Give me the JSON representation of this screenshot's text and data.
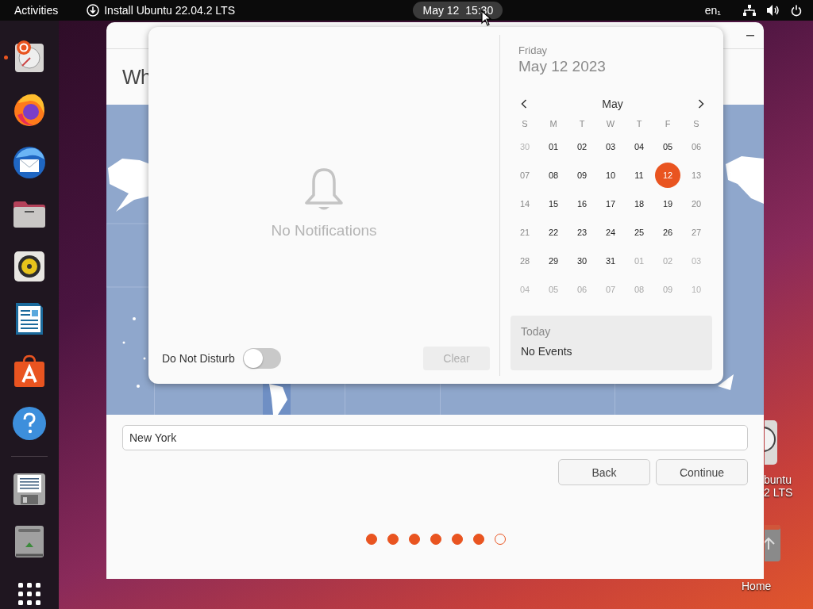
{
  "top_bar": {
    "activities": "Activities",
    "app_menu": "Install Ubuntu 22.04.2 LTS",
    "clock": "May 12  15:30",
    "clock_selected": true,
    "keyboard_layout": "en₁"
  },
  "dock": {
    "items": [
      {
        "kind": "installer",
        "running": true
      },
      {
        "kind": "firefox",
        "running": false
      },
      {
        "kind": "thunderbird",
        "running": false
      },
      {
        "kind": "files",
        "running": false
      },
      {
        "kind": "rhythmbox",
        "running": false
      },
      {
        "kind": "writer",
        "running": false
      },
      {
        "kind": "software",
        "running": false
      },
      {
        "kind": "help",
        "running": false
      },
      {
        "kind": "separator"
      },
      {
        "kind": "save",
        "running": false
      },
      {
        "kind": "trash",
        "running": false
      },
      {
        "kind": "apps",
        "running": false
      }
    ]
  },
  "desktop_icons": [
    {
      "kind": "installer",
      "label_lines": [
        "buntu",
        "2 LTS"
      ]
    },
    {
      "kind": "home",
      "label_lines": [
        "Home"
      ]
    }
  ],
  "installer": {
    "heading": "Wh",
    "location": "New York",
    "buttons": [
      "Back",
      "Continue"
    ],
    "progress": [
      {
        "filled": true
      },
      {
        "filled": true
      },
      {
        "filled": true
      },
      {
        "filled": true
      },
      {
        "filled": true
      },
      {
        "filled": true
      },
      {
        "filled": false
      }
    ]
  },
  "popover": {
    "notifications": {
      "empty_text": "No Notifications",
      "dnd_label": "Do Not Disturb",
      "dnd_on": false,
      "clear": "Clear",
      "clear_disabled": true
    },
    "calendar": {
      "weekday": "Friday",
      "date": "May 12 2023",
      "month": "May",
      "day_headers": [
        "S",
        "M",
        "T",
        "W",
        "T",
        "F",
        "S"
      ],
      "weeks": [
        [
          {
            "day": "30",
            "kind": "other_weekend",
            "selected": false
          },
          {
            "day": "01",
            "kind": "weekday",
            "selected": false
          },
          {
            "day": "02",
            "kind": "weekday",
            "selected": false
          },
          {
            "day": "03",
            "kind": "weekday",
            "selected": false
          },
          {
            "day": "04",
            "kind": "weekday",
            "selected": false
          },
          {
            "day": "05",
            "kind": "weekday",
            "selected": false
          },
          {
            "day": "06",
            "kind": "weekend",
            "selected": false
          }
        ],
        [
          {
            "day": "07",
            "kind": "weekend",
            "selected": false
          },
          {
            "day": "08",
            "kind": "weekday",
            "selected": false
          },
          {
            "day": "09",
            "kind": "weekday",
            "selected": false
          },
          {
            "day": "10",
            "kind": "weekday",
            "selected": false
          },
          {
            "day": "11",
            "kind": "weekday",
            "selected": false
          },
          {
            "day": "12",
            "kind": "weekday",
            "selected": true
          },
          {
            "day": "13",
            "kind": "weekend",
            "selected": false
          }
        ],
        [
          {
            "day": "14",
            "kind": "weekend",
            "selected": false
          },
          {
            "day": "15",
            "kind": "weekday",
            "selected": false
          },
          {
            "day": "16",
            "kind": "weekday",
            "selected": false
          },
          {
            "day": "17",
            "kind": "weekday",
            "selected": false
          },
          {
            "day": "18",
            "kind": "weekday",
            "selected": false
          },
          {
            "day": "19",
            "kind": "weekday",
            "selected": false
          },
          {
            "day": "20",
            "kind": "weekend",
            "selected": false
          }
        ],
        [
          {
            "day": "21",
            "kind": "weekend",
            "selected": false
          },
          {
            "day": "22",
            "kind": "weekday",
            "selected": false
          },
          {
            "day": "23",
            "kind": "weekday",
            "selected": false
          },
          {
            "day": "24",
            "kind": "weekday",
            "selected": false
          },
          {
            "day": "25",
            "kind": "weekday",
            "selected": false
          },
          {
            "day": "26",
            "kind": "weekday",
            "selected": false
          },
          {
            "day": "27",
            "kind": "weekend",
            "selected": false
          }
        ],
        [
          {
            "day": "28",
            "kind": "weekend",
            "selected": false
          },
          {
            "day": "29",
            "kind": "weekday",
            "selected": false
          },
          {
            "day": "30",
            "kind": "weekday",
            "selected": false
          },
          {
            "day": "31",
            "kind": "weekday",
            "selected": false
          },
          {
            "day": "01",
            "kind": "other",
            "selected": false
          },
          {
            "day": "02",
            "kind": "other",
            "selected": false
          },
          {
            "day": "03",
            "kind": "other_weekend",
            "selected": false
          }
        ],
        [
          {
            "day": "04",
            "kind": "other_weekend",
            "selected": false
          },
          {
            "day": "05",
            "kind": "other",
            "selected": false
          },
          {
            "day": "06",
            "kind": "other",
            "selected": false
          },
          {
            "day": "07",
            "kind": "other",
            "selected": false
          },
          {
            "day": "08",
            "kind": "other",
            "selected": false
          },
          {
            "day": "09",
            "kind": "other",
            "selected": false
          },
          {
            "day": "10",
            "kind": "other_weekend",
            "selected": false
          }
        ]
      ],
      "events": {
        "title": "Today",
        "text": "No Events"
      }
    }
  }
}
